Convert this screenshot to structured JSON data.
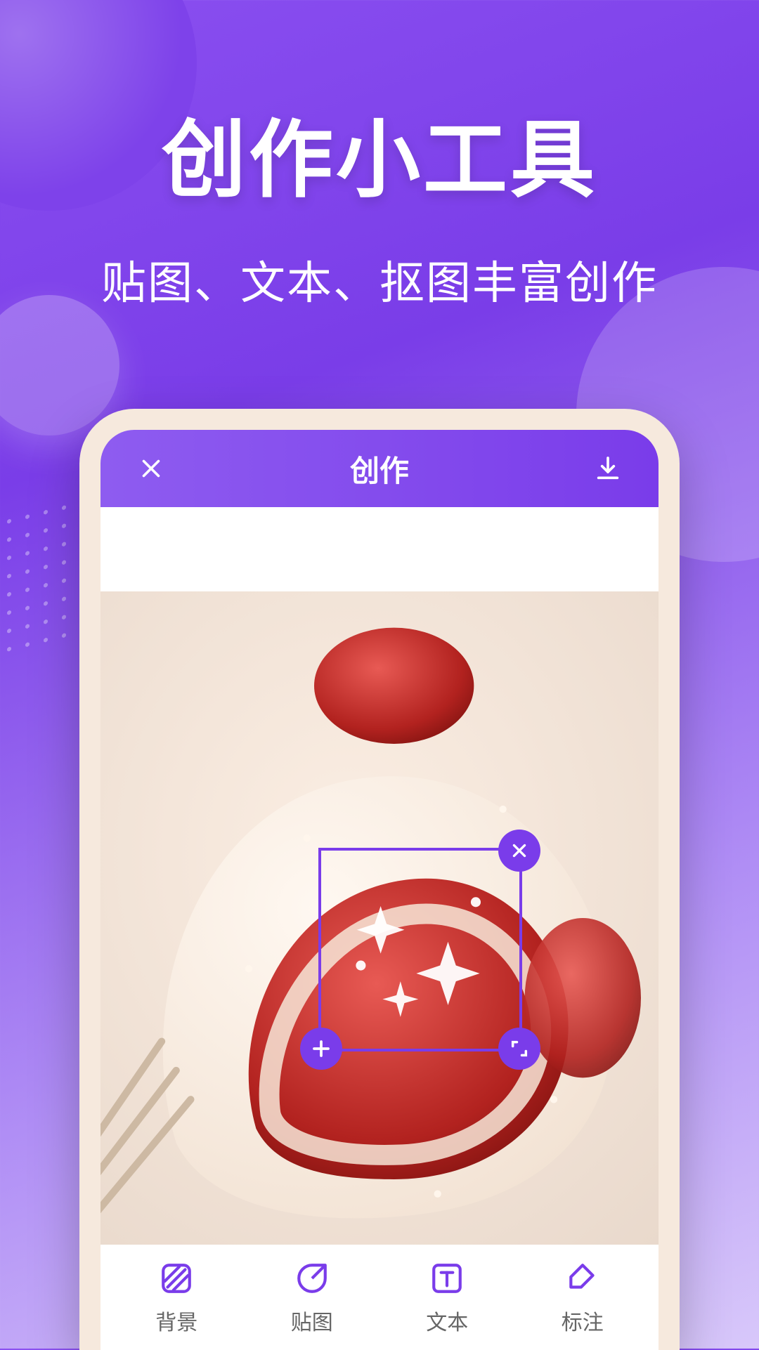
{
  "hero": {
    "title": "创作小工具",
    "subtitle": "贴图、文本、抠图丰富创作"
  },
  "app": {
    "header": {
      "title": "创作"
    },
    "tools": [
      {
        "id": "background",
        "label": "背景"
      },
      {
        "id": "sticker",
        "label": "贴图"
      },
      {
        "id": "text",
        "label": "文本"
      },
      {
        "id": "annotate",
        "label": "标注"
      }
    ]
  },
  "colors": {
    "accent": "#7a3cea"
  }
}
